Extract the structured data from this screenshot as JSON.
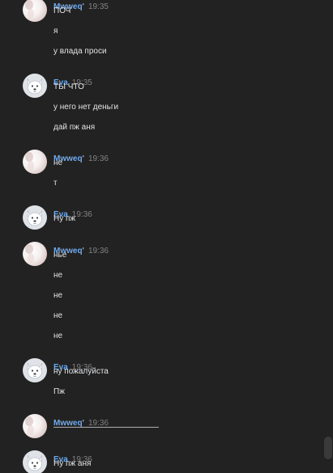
{
  "chat": {
    "colors": {
      "background": "#222222",
      "author": "#71aaeb",
      "text": "#e1e3e6",
      "time": "#828282"
    },
    "groups": [
      {
        "author": "Mwweq'",
        "time": "19:35",
        "avatar": "photo-avatar",
        "messages": [
          "ПОЧ",
          "я",
          "у влада проси"
        ]
      },
      {
        "author": "Eva",
        "time": "19:35",
        "avatar": "dog-avatar",
        "messages": [
          "ТЫ ЧТО",
          "у него нет деньги",
          "дай пж аня"
        ]
      },
      {
        "author": "Mwweq'",
        "time": "19:36",
        "avatar": "photo-avatar",
        "messages": [
          "не",
          "т"
        ]
      },
      {
        "author": "Eva",
        "time": "19:36",
        "avatar": "dog-avatar",
        "messages": [
          "Ну пж"
        ]
      },
      {
        "author": "Mwweq'",
        "time": "19:36",
        "avatar": "photo-avatar",
        "messages": [
          "нье",
          "не",
          "не",
          "не",
          "не"
        ]
      },
      {
        "author": "Eva",
        "time": "19:36",
        "avatar": "dog-avatar",
        "messages": [
          "ну пожалуйста",
          "Пж"
        ]
      },
      {
        "author": "Mwweq'",
        "time": "19:36",
        "avatar": "photo-avatar",
        "messages": [
          "—————————————"
        ]
      },
      {
        "author": "Eva",
        "time": "19:36",
        "avatar": "dog-avatar",
        "messages": [
          "Ну пж аня"
        ]
      }
    ]
  }
}
